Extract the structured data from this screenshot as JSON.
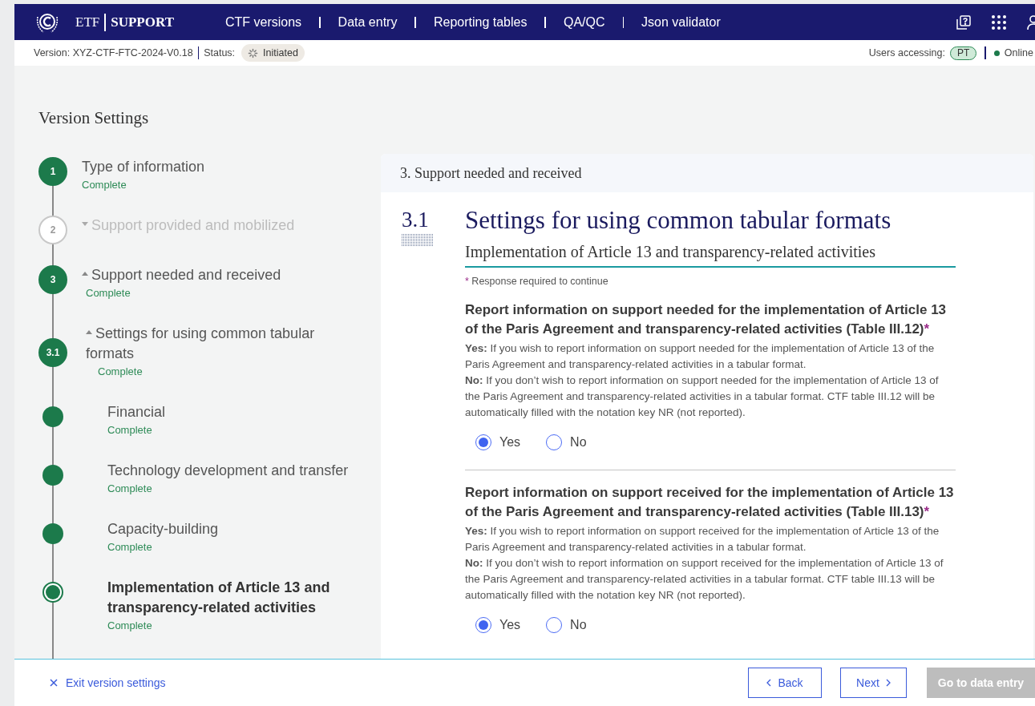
{
  "header": {
    "brand_left": "ETF",
    "brand_right": "SUPPORT",
    "nav": [
      {
        "label": "CTF versions"
      },
      {
        "label": "Data entry"
      },
      {
        "label": "Reporting tables"
      },
      {
        "label": "QA/QC"
      },
      {
        "label": "Json validator"
      }
    ]
  },
  "status_bar": {
    "version_label": "Version:",
    "version": "XYZ-CTF-FTC-2024-V0.18",
    "status_label": "Status:",
    "status": "Initiated",
    "users_label": "Users accessing:",
    "users": [
      "PT"
    ],
    "connection": "Online"
  },
  "page_title": "Version Settings",
  "steps": [
    {
      "marker": "1",
      "title": "Type of information",
      "status": "Complete",
      "active": true
    },
    {
      "marker": "2",
      "title": "Support provided and mobilized",
      "active": false,
      "expanded": false
    },
    {
      "marker": "3",
      "title": "Support needed and received",
      "status": "Complete",
      "active": true,
      "expanded": true,
      "children": [
        {
          "marker": "3.1",
          "title": "Settings for using common tabular formats",
          "status": "Complete",
          "active": true,
          "expanded": true,
          "children": [
            {
              "title": "Financial",
              "status": "Complete",
              "active": true,
              "current": false
            },
            {
              "title": "Technology development and transfer",
              "status": "Complete",
              "active": true,
              "current": false
            },
            {
              "title": "Capacity-building",
              "status": "Complete",
              "active": true,
              "current": false
            },
            {
              "title": "Implementation of Article 13 and transparency-related activities",
              "status": "Complete",
              "active": true,
              "current": true
            }
          ]
        }
      ]
    }
  ],
  "panel": {
    "section": "3. Support needed and received",
    "number": "3.1",
    "title": "Settings for using common tabular formats",
    "subtitle": "Implementation of Article 13 and transparency-related activities",
    "required_note": {
      "mark": "*",
      "text": "Response required to continue"
    },
    "questions": [
      {
        "title": "Report information on support needed for the implementation of Article 13 of the Paris Agreement and transparency-related activities (Table III.12)",
        "required_mark": "*",
        "yes_text": "**Yes:** If you wish to report information on support needed for the implementation of Article 13 of the Paris Agreement and transparency-related activities in a tabular format.",
        "no_text": "**No:** If you don’t wish to report information on support needed for the implementation of Article 13 of the Paris Agreement and transparency-related activities in a tabular format. CTF table III.12 will be automatically filled with the notation key NR (not reported).",
        "options": [
          {
            "label": "Yes",
            "selected": true
          },
          {
            "label": "No",
            "selected": false
          }
        ]
      },
      {
        "title": "Report information on support received for the implementation of Article 13 of the Paris Agreement and transparency-related activities (Table III.13)",
        "required_mark": "*",
        "yes_text": "**Yes:** If you wish to report information on support received for the implementation of Article 13 of the Paris Agreement and transparency-related activities in a tabular format.",
        "no_text": "**No:** If you don’t wish to report information on support received for the implementation of Article 13 of the Paris Agreement and transparency-related activities in a tabular format. CTF table III.13 will be automatically filled with the notation key NR (not reported).",
        "options": [
          {
            "label": "Yes",
            "selected": true
          },
          {
            "label": "No",
            "selected": false
          }
        ]
      }
    ]
  },
  "footer": {
    "exit": "Exit version settings",
    "back": "Back",
    "next": "Next",
    "go": {
      "label": "Go to data entry",
      "disabled": true
    }
  }
}
